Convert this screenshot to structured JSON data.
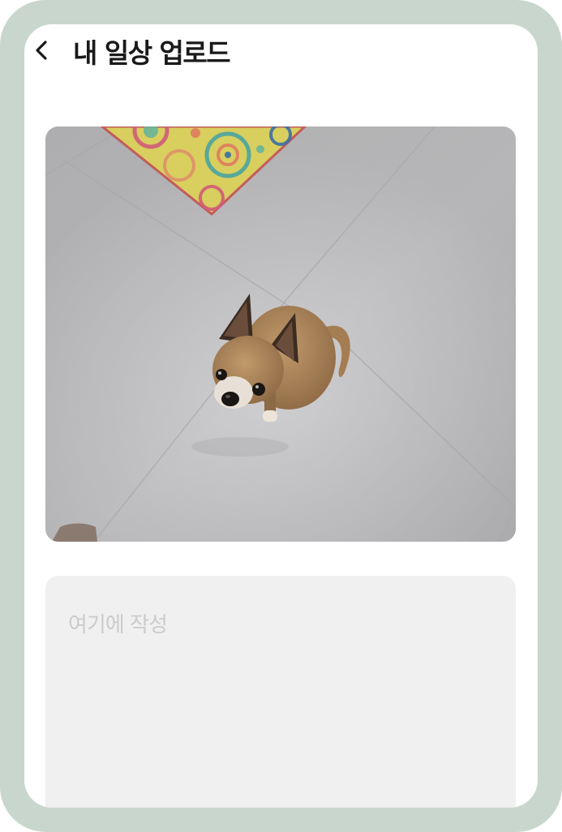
{
  "header": {
    "title": "내 일상 업로드",
    "back_icon": "chevron-left-icon"
  },
  "photo": {
    "subject": "dog-photo"
  },
  "composer": {
    "placeholder": "여기에 작성",
    "value": ""
  },
  "colors": {
    "frame": "#c9d6cd",
    "screen": "#ffffff",
    "title_text": "#1a1a1a",
    "textbox_bg": "#f0f0f0",
    "placeholder_text": "#cbcbcb"
  }
}
